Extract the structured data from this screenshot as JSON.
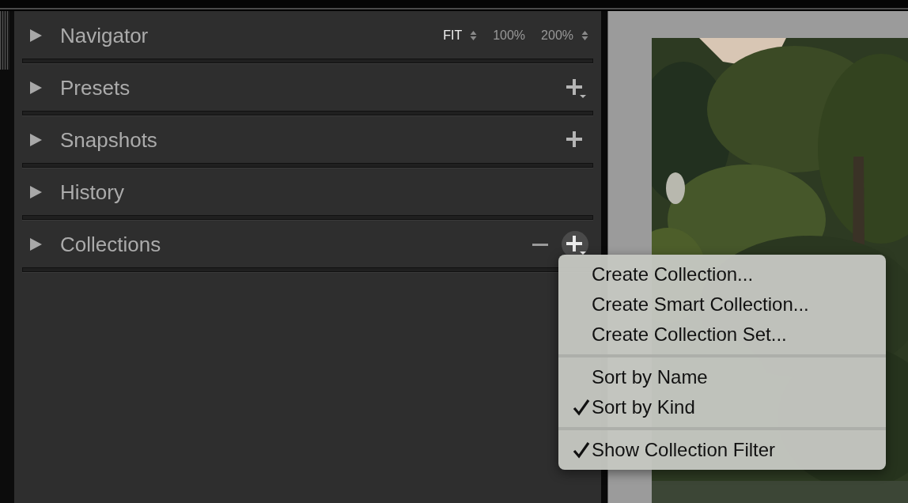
{
  "panels": [
    {
      "title": "Navigator",
      "expanded": false,
      "controls": [
        {
          "kind": "zoom",
          "label": "FIT",
          "selected": true,
          "stepper": true
        },
        {
          "kind": "zoom",
          "label": "100%",
          "selected": false,
          "stepper": false
        },
        {
          "kind": "zoom",
          "label": "200%",
          "selected": false,
          "stepper": true
        }
      ]
    },
    {
      "title": "Presets",
      "expanded": false,
      "controls": [
        {
          "kind": "add-menu",
          "pressed": false
        }
      ]
    },
    {
      "title": "Snapshots",
      "expanded": false,
      "controls": [
        {
          "kind": "add",
          "pressed": false
        }
      ]
    },
    {
      "title": "History",
      "expanded": false
    },
    {
      "title": "Collections",
      "expanded": false,
      "controls": [
        {
          "kind": "remove",
          "pressed": false
        },
        {
          "kind": "add-menu",
          "pressed": true
        }
      ]
    }
  ],
  "menu": {
    "groups": [
      [
        {
          "label": "Create Collection...",
          "checked": false
        },
        {
          "label": "Create Smart Collection...",
          "checked": false
        },
        {
          "label": "Create Collection Set...",
          "checked": false
        }
      ],
      [
        {
          "label": "Sort by Name",
          "checked": false
        },
        {
          "label": "Sort by Kind",
          "checked": true
        }
      ],
      [
        {
          "label": "Show Collection Filter",
          "checked": true
        }
      ]
    ]
  }
}
